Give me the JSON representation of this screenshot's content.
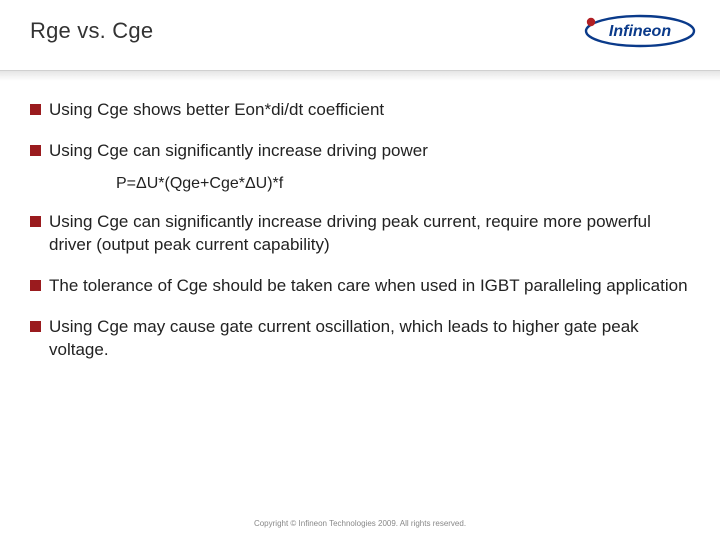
{
  "title": "Rge vs. Cge",
  "logo_text": "Infineon",
  "bullets": [
    {
      "text": "Using Cge shows better Eon*di/dt coefficient"
    },
    {
      "text": "Using Cge can significantly increase driving power",
      "formula": "P=ΔU*(Qge+Cge*ΔU)*f"
    },
    {
      "text": "Using Cge can significantly increase driving peak current, require more powerful driver (output peak current capability)"
    },
    {
      "text": "The tolerance of Cge should be taken care when used in IGBT paralleling application"
    },
    {
      "text": "Using Cge may cause gate current oscillation, which leads to higher gate peak voltage."
    }
  ],
  "footer": "Copyright © Infineon Technologies 2009. All rights reserved."
}
